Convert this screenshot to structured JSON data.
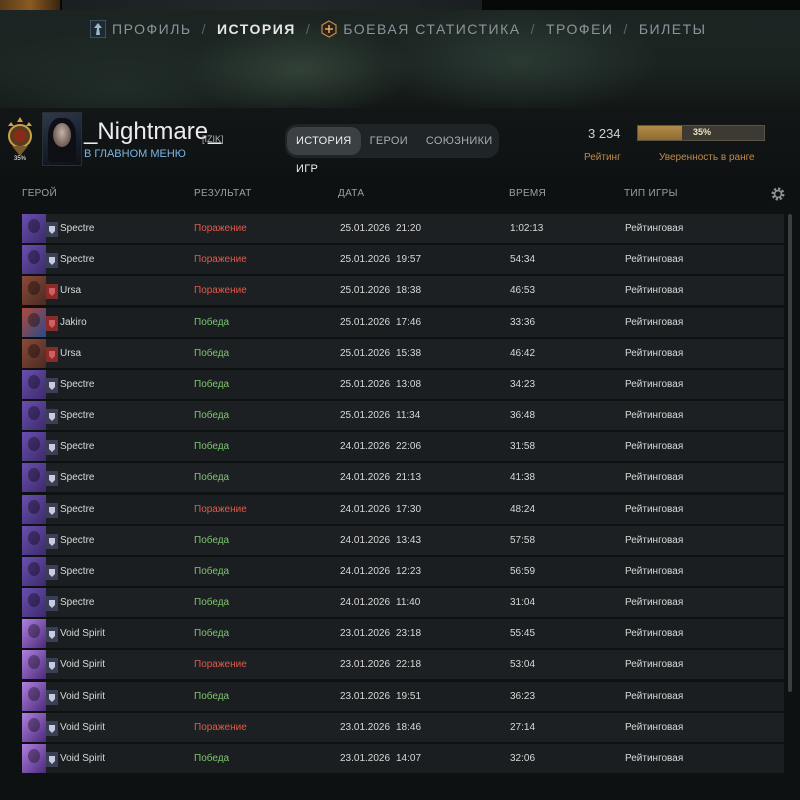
{
  "nav": {
    "items": [
      {
        "label": "ПРОФИЛЬ",
        "active": false,
        "icon": "profile-icon"
      },
      {
        "label": "ИСТОРИЯ",
        "active": true
      },
      {
        "label": "БОЕВАЯ СТАТИСТИКА",
        "active": false,
        "icon": "battlepass-icon"
      },
      {
        "label": "ТРОФЕИ",
        "active": false
      },
      {
        "label": "БИЛЕТЫ",
        "active": false
      }
    ],
    "separator": "/"
  },
  "profile": {
    "medal_text": "35%",
    "name": "_Nightmare_",
    "tag": "[IZIK]",
    "status": "В ГЛАВНОМ МЕНЮ",
    "tabs": [
      {
        "label": "ИСТОРИЯ ИГР",
        "active": true
      },
      {
        "label": "ГЕРОИ",
        "active": false
      },
      {
        "label": "СОЮЗНИКИ",
        "active": false
      }
    ],
    "rating_value": "3 234",
    "rating_label": "Рейтинг",
    "confidence_value": "35%",
    "confidence_fraction": 0.35,
    "confidence_label": "Уверенность в ранге"
  },
  "table": {
    "headers": {
      "hero": "ГЕРОЙ",
      "result": "РЕЗУЛЬТАТ",
      "date": "ДАТА",
      "duration": "ВРЕМЯ",
      "type": "ТИП ИГРЫ"
    },
    "rows": [
      {
        "hero": "Spectre",
        "result": "Поражение",
        "win": false,
        "date": "25.01.2026",
        "time": "21:20",
        "duration": "1:02:13",
        "type": "Рейтинговая"
      },
      {
        "hero": "Spectre",
        "result": "Поражение",
        "win": false,
        "date": "25.01.2026",
        "time": "19:57",
        "duration": "54:34",
        "type": "Рейтинговая"
      },
      {
        "hero": "Ursa",
        "result": "Поражение",
        "win": false,
        "date": "25.01.2026",
        "time": "18:38",
        "duration": "46:53",
        "type": "Рейтинговая"
      },
      {
        "hero": "Jakiro",
        "result": "Победа",
        "win": true,
        "date": "25.01.2026",
        "time": "17:46",
        "duration": "33:36",
        "type": "Рейтинговая"
      },
      {
        "hero": "Ursa",
        "result": "Победа",
        "win": true,
        "date": "25.01.2026",
        "time": "15:38",
        "duration": "46:42",
        "type": "Рейтинговая"
      },
      {
        "hero": "Spectre",
        "result": "Победа",
        "win": true,
        "date": "25.01.2026",
        "time": "13:08",
        "duration": "34:23",
        "type": "Рейтинговая"
      },
      {
        "hero": "Spectre",
        "result": "Победа",
        "win": true,
        "date": "25.01.2026",
        "time": "11:34",
        "duration": "36:48",
        "type": "Рейтинговая"
      },
      {
        "hero": "Spectre",
        "result": "Победа",
        "win": true,
        "date": "24.01.2026",
        "time": "22:06",
        "duration": "31:58",
        "type": "Рейтинговая"
      },
      {
        "hero": "Spectre",
        "result": "Победа",
        "win": true,
        "date": "24.01.2026",
        "time": "21:13",
        "duration": "41:38",
        "type": "Рейтинговая"
      },
      {
        "hero": "Spectre",
        "result": "Поражение",
        "win": false,
        "date": "24.01.2026",
        "time": "17:30",
        "duration": "48:24",
        "type": "Рейтинговая"
      },
      {
        "hero": "Spectre",
        "result": "Победа",
        "win": true,
        "date": "24.01.2026",
        "time": "13:43",
        "duration": "57:58",
        "type": "Рейтинговая"
      },
      {
        "hero": "Spectre",
        "result": "Победа",
        "win": true,
        "date": "24.01.2026",
        "time": "12:23",
        "duration": "56:59",
        "type": "Рейтинговая"
      },
      {
        "hero": "Spectre",
        "result": "Победа",
        "win": true,
        "date": "24.01.2026",
        "time": "11:40",
        "duration": "31:04",
        "type": "Рейтинговая"
      },
      {
        "hero": "Void Spirit",
        "result": "Победа",
        "win": true,
        "date": "23.01.2026",
        "time": "23:18",
        "duration": "55:45",
        "type": "Рейтинговая"
      },
      {
        "hero": "Void Spirit",
        "result": "Поражение",
        "win": false,
        "date": "23.01.2026",
        "time": "22:18",
        "duration": "53:04",
        "type": "Рейтинговая"
      },
      {
        "hero": "Void Spirit",
        "result": "Победа",
        "win": true,
        "date": "23.01.2026",
        "time": "19:51",
        "duration": "36:23",
        "type": "Рейтинговая"
      },
      {
        "hero": "Void Spirit",
        "result": "Поражение",
        "win": false,
        "date": "23.01.2026",
        "time": "18:46",
        "duration": "27:14",
        "type": "Рейтинговая"
      },
      {
        "hero": "Void Spirit",
        "result": "Победа",
        "win": true,
        "date": "23.01.2026",
        "time": "14:07",
        "duration": "32:06",
        "type": "Рейтинговая"
      }
    ]
  },
  "colors": {
    "win": "#7fc471",
    "loss": "#e05a4a",
    "accent": "#c08a4a",
    "status": "#7db6e3"
  }
}
